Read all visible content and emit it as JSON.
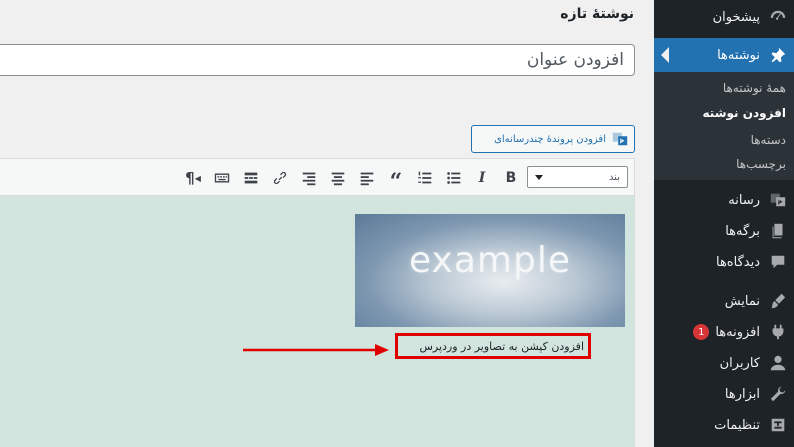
{
  "page": {
    "title": "نوشتهٔ تازه"
  },
  "title_field": {
    "placeholder": "افزودن عنوان"
  },
  "add_media": {
    "label": "افزودن پروندهٔ چندرسانه‌ای",
    "icon": "media-icon"
  },
  "editor": {
    "format_select": {
      "value": "بند"
    },
    "toolbar": [
      {
        "name": "bold-button",
        "icon": "B"
      },
      {
        "name": "italic-button",
        "icon": "I"
      },
      {
        "name": "bullet-list-button",
        "icon": "bullet-list-icon"
      },
      {
        "name": "numbered-list-button",
        "icon": "numbered-list-icon"
      },
      {
        "name": "blockquote-button",
        "icon": "“"
      },
      {
        "name": "align-left-button",
        "icon": "align-left-icon"
      },
      {
        "name": "align-center-button",
        "icon": "align-center-icon"
      },
      {
        "name": "align-right-button",
        "icon": "align-right-icon"
      },
      {
        "name": "link-button",
        "icon": "link-icon"
      },
      {
        "name": "read-more-button",
        "icon": "read-more-icon"
      },
      {
        "name": "toolbar-toggle-button",
        "icon": "keyboard-icon"
      },
      {
        "name": "rtl-button",
        "icon": "¶"
      }
    ],
    "image_text": "example",
    "caption": "افزودن کپشن به تصاویر در وردپرس"
  },
  "sidebar": {
    "items": [
      {
        "label": "پیشخوان",
        "icon": "dashboard-icon"
      },
      {
        "label": "نوشته‌ها",
        "icon": "pin-icon",
        "current": true
      },
      {
        "label": "رسانه",
        "icon": "media-icon"
      },
      {
        "label": "برگه‌ها",
        "icon": "pages-icon"
      },
      {
        "label": "دیدگاه‌ها",
        "icon": "comments-icon"
      },
      {
        "label": "نمایش",
        "icon": "appearance-icon"
      },
      {
        "label": "افزونه‌ها",
        "icon": "plugins-icon",
        "badge": "1"
      },
      {
        "label": "کاربران",
        "icon": "users-icon"
      },
      {
        "label": "ابزارها",
        "icon": "tools-icon"
      },
      {
        "label": "تنظیمات",
        "icon": "settings-icon"
      }
    ],
    "submenu": [
      {
        "label": "همهٔ نوشته‌ها"
      },
      {
        "label": "افزودن نوشته",
        "current": true
      },
      {
        "label": "دسته‌ها"
      },
      {
        "label": "برچسب‌ها"
      }
    ]
  },
  "colors": {
    "sidebar_bg": "#1d2327",
    "accent": "#2271b1",
    "editor_bg": "#d1e4dd",
    "highlight": "#e10000",
    "badge": "#d63638"
  }
}
